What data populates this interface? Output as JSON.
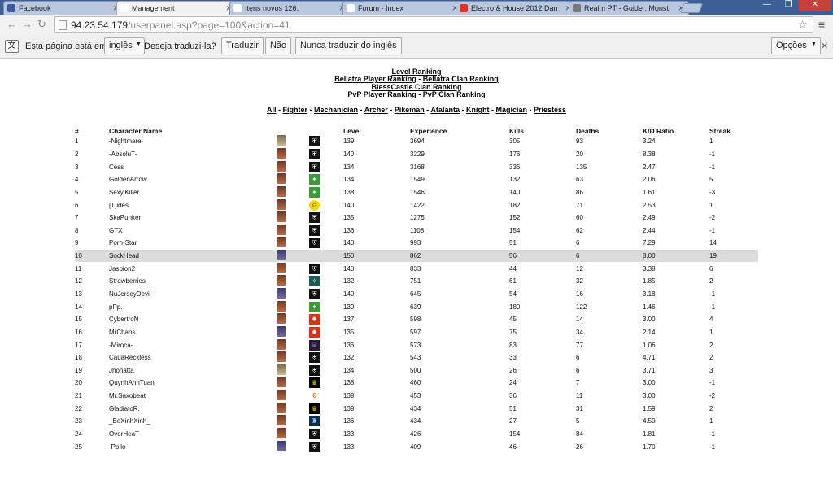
{
  "browser": {
    "tabs": [
      {
        "title": "Facebook",
        "active": false,
        "favicon_color": "#3b5998"
      },
      {
        "title": "Management",
        "active": true,
        "favicon_color": "#ffffff"
      },
      {
        "title": "Itens novos 126.",
        "active": false,
        "favicon_color": "#ffffff"
      },
      {
        "title": "Forum - Index",
        "active": false,
        "favicon_color": "#ffffff"
      },
      {
        "title": "Electro & House 2012 Dan",
        "active": false,
        "favicon_color": "#e52d27"
      },
      {
        "title": "Realm PT - Guide : Monst",
        "active": false,
        "favicon_color": "#777777"
      }
    ],
    "url_host": "94.23.54.179",
    "url_path": "/userpanel.asp?page=100&action=41"
  },
  "translate_bar": {
    "prefix": "Esta página está em",
    "language": "inglês",
    "question": "Deseja traduzi-la?",
    "translate_btn": "Traduzir",
    "no_btn": "Não",
    "never_btn": "Nunca traduzir do inglês",
    "options_btn": "Opções"
  },
  "header_links": {
    "level_ranking": "Level Ranking",
    "bellatra_player": "Bellatra Player Ranking",
    "bellatra_clan": "Bellatra Clan Ranking",
    "blesscastle_clan": "BlessCastle Clan Ranking",
    "pvp_player": "PvP Player Ranking",
    "pvp_clan": "PvP Clan Ranking"
  },
  "class_filters": [
    "All",
    "Fighter",
    "Mechanician",
    "Archer",
    "Pikeman",
    "Atalanta",
    "Knight",
    "Magician",
    "Priestess"
  ],
  "columns": {
    "num": "#",
    "name": "Character Name",
    "level": "Level",
    "experience": "Experience",
    "kills": "Kills",
    "deaths": "Deaths",
    "kd": "K/D Ratio",
    "streak": "Streak"
  },
  "rows": [
    {
      "num": "1",
      "name": "-Nightmare-",
      "level": "139",
      "experience": "3694",
      "kills": "305",
      "deaths": "93",
      "kd": "3.24",
      "streak": "1",
      "char": "kind2",
      "clan": "dark"
    },
    {
      "num": "2",
      "name": "-AbsoluT-",
      "level": "140",
      "experience": "3229",
      "kills": "176",
      "deaths": "20",
      "kd": "8.38",
      "streak": "-1",
      "char": "kind0",
      "clan": "dark"
    },
    {
      "num": "3",
      "name": "Cess",
      "level": "134",
      "experience": "3168",
      "kills": "336",
      "deaths": "135",
      "kd": "2.47",
      "streak": "-1",
      "char": "kind0",
      "clan": "dark"
    },
    {
      "num": "4",
      "name": "GoldenArrow",
      "level": "134",
      "experience": "1549",
      "kills": "132",
      "deaths": "63",
      "kd": "2.06",
      "streak": "5",
      "char": "kind0",
      "clan": "green"
    },
    {
      "num": "5",
      "name": "Sexy.Killer",
      "level": "138",
      "experience": "1546",
      "kills": "140",
      "deaths": "86",
      "kd": "1.61",
      "streak": "-3",
      "char": "kind0",
      "clan": "green"
    },
    {
      "num": "6",
      "name": "[T]ides",
      "level": "140",
      "experience": "1422",
      "kills": "182",
      "deaths": "71",
      "kd": "2.53",
      "streak": "1",
      "char": "kind0",
      "clan": "yellow"
    },
    {
      "num": "7",
      "name": "SkaPunker",
      "level": "135",
      "experience": "1275",
      "kills": "152",
      "deaths": "60",
      "kd": "2.49",
      "streak": "-2",
      "char": "kind0",
      "clan": "dark"
    },
    {
      "num": "8",
      "name": "GTX",
      "level": "136",
      "experience": "1108",
      "kills": "154",
      "deaths": "62",
      "kd": "2.44",
      "streak": "-1",
      "char": "kind0",
      "clan": "dark"
    },
    {
      "num": "9",
      "name": "Porn-Star",
      "level": "140",
      "experience": "993",
      "kills": "51",
      "deaths": "6",
      "kd": "7.29",
      "streak": "14",
      "char": "kind0",
      "clan": "dark"
    },
    {
      "num": "10",
      "name": "SockHead",
      "level": "150",
      "experience": "862",
      "kills": "56",
      "deaths": "6",
      "kd": "8.00",
      "streak": "19",
      "char": "kind1",
      "clan": "none",
      "highlight": true
    },
    {
      "num": "11",
      "name": "Jaspion2",
      "level": "140",
      "experience": "833",
      "kills": "44",
      "deaths": "12",
      "kd": "3.38",
      "streak": "6",
      "char": "kind0",
      "clan": "dark"
    },
    {
      "num": "12",
      "name": "Strawberries",
      "level": "132",
      "experience": "751",
      "kills": "61",
      "deaths": "32",
      "kd": "1.85",
      "streak": "2",
      "char": "kind0",
      "clan": "teal"
    },
    {
      "num": "13",
      "name": "NuJerseyDevil",
      "level": "140",
      "experience": "645",
      "kills": "54",
      "deaths": "16",
      "kd": "3.18",
      "streak": "-1",
      "char": "kind1",
      "clan": "dark"
    },
    {
      "num": "14",
      "name": "pPp.",
      "level": "139",
      "experience": "639",
      "kills": "180",
      "deaths": "122",
      "kd": "1.46",
      "streak": "-1",
      "char": "kind0",
      "clan": "green"
    },
    {
      "num": "15",
      "name": "CybertroN",
      "level": "137",
      "experience": "598",
      "kills": "45",
      "deaths": "14",
      "kd": "3.00",
      "streak": "4",
      "char": "kind0",
      "clan": "orange"
    },
    {
      "num": "16",
      "name": "MrChaos",
      "level": "135",
      "experience": "597",
      "kills": "75",
      "deaths": "34",
      "kd": "2.14",
      "streak": "1",
      "char": "kind1",
      "clan": "orange"
    },
    {
      "num": "17",
      "name": "-Miroca-",
      "level": "136",
      "experience": "573",
      "kills": "83",
      "deaths": "77",
      "kd": "1.06",
      "streak": "2",
      "char": "kind0",
      "clan": "purple"
    },
    {
      "num": "18",
      "name": "CauaReckless",
      "level": "132",
      "experience": "543",
      "kills": "33",
      "deaths": "6",
      "kd": "4.71",
      "streak": "2",
      "char": "kind0",
      "clan": "dark"
    },
    {
      "num": "19",
      "name": "Jhonatta",
      "level": "134",
      "experience": "500",
      "kills": "26",
      "deaths": "6",
      "kd": "3.71",
      "streak": "3",
      "char": "kind2",
      "clan": "dark"
    },
    {
      "num": "20",
      "name": "QuynhAnhTuan",
      "level": "138",
      "experience": "460",
      "kills": "24",
      "deaths": "7",
      "kd": "3.00",
      "streak": "-1",
      "char": "kind0",
      "clan": "gold"
    },
    {
      "num": "21",
      "name": "Mr.Saxobeat",
      "level": "139",
      "experience": "453",
      "kills": "36",
      "deaths": "11",
      "kd": "3.00",
      "streak": "-2",
      "char": "kind0",
      "clan": "amber"
    },
    {
      "num": "22",
      "name": "GladiatoR.",
      "level": "139",
      "experience": "434",
      "kills": "51",
      "deaths": "31",
      "kd": "1.59",
      "streak": "2",
      "char": "kind0",
      "clan": "gold"
    },
    {
      "num": "23",
      "name": "_BeXinhXinh_",
      "level": "136",
      "experience": "434",
      "kills": "27",
      "deaths": "5",
      "kd": "4.50",
      "streak": "1",
      "char": "kind0",
      "clan": "blue"
    },
    {
      "num": "24",
      "name": "OverHeaT",
      "level": "133",
      "experience": "426",
      "kills": "154",
      "deaths": "84",
      "kd": "1.81",
      "streak": "-1",
      "char": "kind0",
      "clan": "dark"
    },
    {
      "num": "25",
      "name": "-Pollo-",
      "level": "133",
      "experience": "409",
      "kills": "46",
      "deaths": "26",
      "kd": "1.70",
      "streak": "-1",
      "char": "kind1",
      "clan": "dark"
    }
  ]
}
